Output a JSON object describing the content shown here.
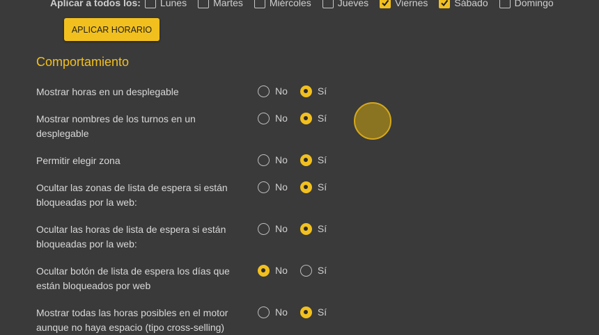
{
  "schedule": {
    "apply_all_label": "Aplicar a todos los:",
    "days": [
      {
        "label": "Lunes",
        "checked": false
      },
      {
        "label": "Martes",
        "checked": false
      },
      {
        "label": "Miércoles",
        "checked": false
      },
      {
        "label": "Jueves",
        "checked": false
      },
      {
        "label": "Viernes",
        "checked": true
      },
      {
        "label": "Sábado",
        "checked": true
      },
      {
        "label": "Domingo",
        "checked": false
      }
    ],
    "apply_button": "APLICAR HORARIO"
  },
  "behavior": {
    "title": "Comportamiento",
    "no_label": "No",
    "yes_label": "Sí",
    "settings": [
      {
        "label": "Mostrar horas en un desplegable",
        "value": "yes"
      },
      {
        "label": "Mostrar nombres de los turnos en un desplegable",
        "value": "yes"
      },
      {
        "label": "Permitir elegir zona",
        "value": "yes"
      },
      {
        "label": "Ocultar las zonas de lista de espera si están bloqueadas por la web:",
        "value": "yes"
      },
      {
        "label": "Ocultar las horas de lista de espera si están bloqueadas por la web:",
        "value": "yes"
      },
      {
        "label": "Ocultar botón de lista de espera los días que están bloqueados por web",
        "value": "no"
      },
      {
        "label": "Mostrar todas las horas posibles en el motor aunque no haya espacio (tipo cross-selling)",
        "value": "yes"
      }
    ]
  },
  "colors": {
    "background": "#3a3a3a",
    "accent": "#f2c01e"
  }
}
